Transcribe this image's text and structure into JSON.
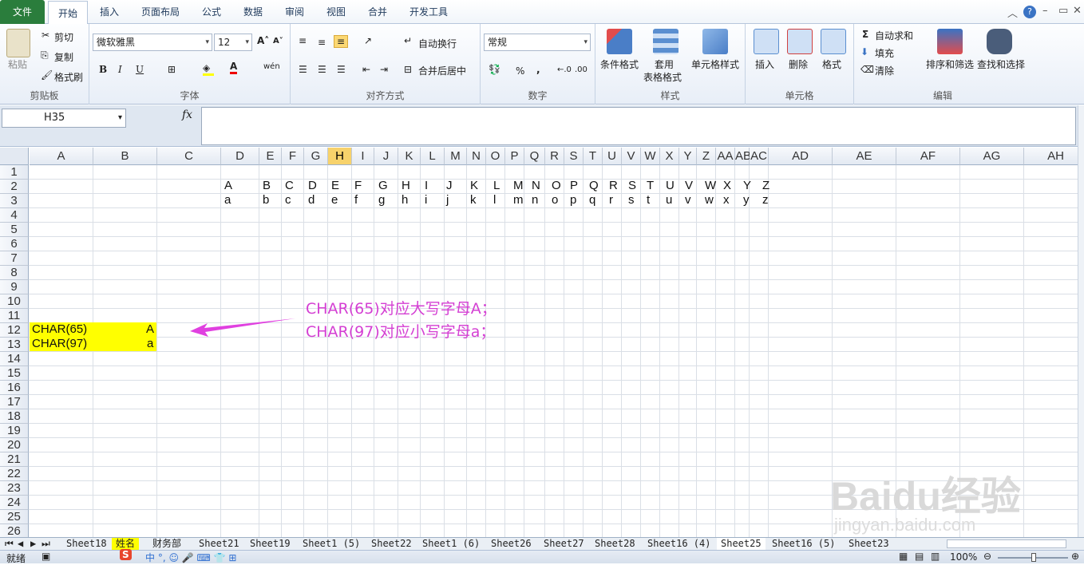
{
  "tabs": {
    "file": "文件",
    "home": "开始",
    "insert": "插入",
    "layout": "页面布局",
    "formula": "公式",
    "data": "数据",
    "review": "审阅",
    "view": "视图",
    "merge": "合并",
    "dev": "开发工具"
  },
  "ribbon": {
    "clipboard": {
      "paste": "粘贴",
      "cut": "剪切",
      "copy": "复制",
      "painter": "格式刷",
      "label": "剪贴板"
    },
    "font": {
      "name": "微软雅黑",
      "size": "12",
      "bold": "B",
      "italic": "I",
      "underline": "U",
      "label": "字体",
      "wen": "wén"
    },
    "align": {
      "wrap": "自动换行",
      "merge": "合并后居中",
      "label": "对齐方式"
    },
    "number": {
      "format": "常规",
      "percent": "%",
      "comma": ",",
      "label": "数字"
    },
    "styles": {
      "cond": "条件格式",
      "table1": "套用",
      "table2": "表格格式",
      "cell": "单元格样式",
      "label": "样式"
    },
    "cells": {
      "insert": "插入",
      "delete": "删除",
      "format": "格式",
      "label": "单元格"
    },
    "editing": {
      "autosum": "自动求和",
      "fill": "填充",
      "clear": "清除",
      "sort": "排序和筛选",
      "find": "查找和选择",
      "label": "编辑"
    }
  },
  "formula_bar": {
    "name_box": "H35",
    "fx": "fx",
    "value": ""
  },
  "columns": [
    "A",
    "B",
    "C",
    "D",
    "E",
    "F",
    "G",
    "H",
    "I",
    "J",
    "K",
    "L",
    "M",
    "N",
    "O",
    "P",
    "Q",
    "R",
    "S",
    "T",
    "U",
    "V",
    "W",
    "X",
    "Y",
    "Z",
    "AA",
    "AB",
    "AC",
    "AD",
    "AE",
    "AF",
    "AG",
    "AH"
  ],
  "rows": [
    "1",
    "2",
    "3",
    "4",
    "5",
    "6",
    "7",
    "8",
    "9",
    "10",
    "11",
    "12",
    "13",
    "14",
    "15",
    "16",
    "17",
    "18",
    "19",
    "20",
    "21",
    "22",
    "23",
    "24",
    "25",
    "26"
  ],
  "upper": [
    "A",
    "B",
    "C",
    "D",
    "E",
    "F",
    "G",
    "H",
    "I",
    "J",
    "K",
    "L",
    "M",
    "N",
    "O",
    "P",
    "Q",
    "R",
    "S",
    "T",
    "U",
    "V",
    "W",
    "X",
    "Y",
    "Z"
  ],
  "lower": [
    "a",
    "b",
    "c",
    "d",
    "e",
    "f",
    "g",
    "h",
    "i",
    "j",
    "k",
    "l",
    "m",
    "n",
    "o",
    "p",
    "q",
    "r",
    "s",
    "t",
    "u",
    "v",
    "w",
    "x",
    "y",
    "z"
  ],
  "cells": {
    "a12": "CHAR(65)",
    "b12": "A",
    "a13": "CHAR(97)",
    "b13": "a"
  },
  "annotation": {
    "line1": "CHAR(65)对应大写字母A；",
    "line2": "CHAR(97)对应小写字母a；"
  },
  "sheets": [
    "Sheet18",
    "姓名",
    "财务部",
    "Sheet21",
    "Sheet19",
    "Sheet1 (5)",
    "Sheet22",
    "Sheet1 (6)",
    "Sheet26",
    "Sheet27",
    "Sheet28",
    "Sheet16 (4)",
    "Sheet25",
    "Sheet16 (5)",
    "Sheet23"
  ],
  "active_sheet": "Sheet25",
  "status": {
    "ready": "就绪",
    "zoom": "100%"
  },
  "watermark": {
    "brand": "Baidu经验",
    "url": "jingyan.baidu.com"
  },
  "colors": {
    "highlight": "#ffff00",
    "annotation": "#d43fd3",
    "file_tab": "#2a7d3c",
    "selected_header": "#f7d26b"
  }
}
